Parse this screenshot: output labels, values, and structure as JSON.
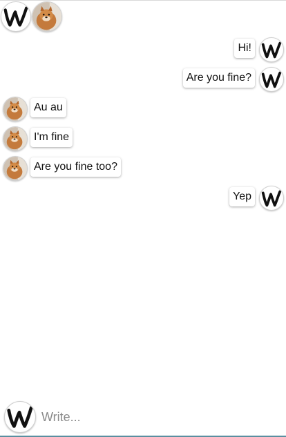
{
  "header": {
    "my_avatar": "w-logo-icon",
    "contact_avatar": "dog-photo-avatar"
  },
  "messages": [
    {
      "from": "me",
      "text": "Hi!"
    },
    {
      "from": "me",
      "text": "Are you fine?"
    },
    {
      "from": "contact",
      "text": "Au au"
    },
    {
      "from": "contact",
      "text": "I'm fine"
    },
    {
      "from": "contact",
      "text": "Are you fine too?"
    },
    {
      "from": "me",
      "text": "Yep"
    }
  ],
  "composer": {
    "placeholder": "Write...",
    "value": ""
  },
  "colors": {
    "accent": "#5a8fa0",
    "bubble_bg": "#ffffff"
  }
}
